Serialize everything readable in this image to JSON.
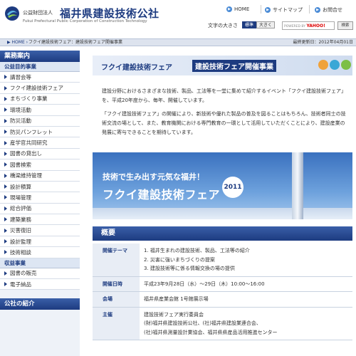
{
  "header": {
    "org_type": "公益財団法人",
    "org_name": "福井県建設技術公社",
    "org_name_en": "Fukui Prefectural Public Corporation of Construction Technology",
    "nav": [
      {
        "label": "HOME"
      },
      {
        "label": "サイトマップ"
      },
      {
        "label": "お問合せ"
      }
    ],
    "font_size_label": "文字の大きさ",
    "font_size_standard": "標準",
    "font_size_large": "大きく",
    "search_powered": "POWERED BY",
    "search_brand": "YAHOO!",
    "search_button": "検索"
  },
  "breadcrumb": {
    "home": "HOME",
    "current": "フクイ建設技術フェア：建設技術フェア開催事業",
    "updated": "最終更新日：2012年04月01日"
  },
  "sidebar": {
    "heading": "業務案内",
    "category1": "公益目的事業",
    "items1": [
      "講習会等",
      "フクイ建設技術フェア",
      "まちづくり事業",
      "環境活動",
      "防災活動",
      "防災パンフレット",
      "産学官共同研究",
      "図書の貸出し",
      "図書検索",
      "橋梁維持管理",
      "設計積算",
      "現場管理",
      "総合評価",
      "建築業務",
      "災害復旧",
      "設計監理",
      "技術相談"
    ],
    "category2": "収益事業",
    "items2": [
      "図書の販売",
      "電子納品"
    ],
    "heading2": "公社の紹介"
  },
  "main": {
    "title_a": "フクイ建設技術フェア",
    "title_b": "建設技術フェア開催事業",
    "para1": "建設分野におけるさまざまな技術、製品、工法等を一堂に集めて紹介するイベント「フクイ建設技術フェア」を、平成20年度から、毎年、開催しています。",
    "para2": "「フクイ建設技術フェア」の開催により、新技術や優れた製品の普及を図ることはもちろん、技術者同士の技術交流の場として、また、教育機関における専門教育の一環として活用していただくことにより、建設産業の発展に寄与できることを期待しています。",
    "promo_line1": "技術で生み出す元気な福井！",
    "promo_line2": "フクイ建設技術フェア",
    "promo_year": "2011",
    "overview_title": "概要",
    "overview": [
      {
        "key": "開催テーマ",
        "values": [
          "1.  福井生まれの建設技術、製品、工法等の紹介",
          "2.  災害に強いまちづくりの提案",
          "3.  建設技術等に係る情報交換の場の提供"
        ]
      },
      {
        "key": "開催日時",
        "values": [
          "平成23年9月28日（水）～29日（木）10:00～16:00"
        ]
      },
      {
        "key": "会場",
        "values": [
          "福井県産業会館  1号館展示場"
        ]
      },
      {
        "key": "主催",
        "values": [
          "建設技術フェア実行委員会",
          "(財)福井県建設技術公社、(社)福井県建設業連合会、",
          "(社)福井県測量設計業協会、福井県県産品活用推進センター"
        ]
      }
    ]
  },
  "colors": {
    "brand_navy": "#1d3b80",
    "accent_blue": "#3a5fa8",
    "sidebar_bg": "#eef2f8"
  },
  "icons": [
    "logo-mark",
    "arrow-icon",
    "triangle-bullet-icon",
    "category-icon"
  ]
}
